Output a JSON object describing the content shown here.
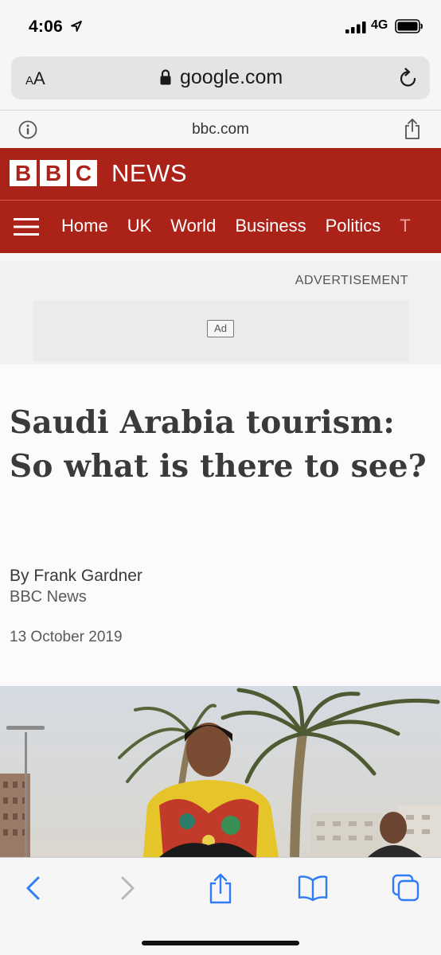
{
  "status_bar": {
    "time": "4:06",
    "network": "4G"
  },
  "browser": {
    "text_size_label_small": "A",
    "text_size_label_large": "A",
    "url": "google.com",
    "site_domain": "bbc.com"
  },
  "bbc": {
    "logo_letters": [
      "B",
      "B",
      "C"
    ],
    "news_word": "NEWS",
    "nav": [
      "Home",
      "UK",
      "World",
      "Business",
      "Politics",
      "T"
    ]
  },
  "ad": {
    "label": "ADVERTISEMENT",
    "badge": "Ad"
  },
  "article": {
    "headline": "Saudi Arabia tourism: So what is there to see?",
    "byline": "By Frank Gardner",
    "publisher": "BBC News",
    "date": "13 October 2019"
  },
  "colors": {
    "bbc_red": "#ab2219",
    "ios_blue": "#2f7cf6"
  },
  "icons": {
    "location": "location-arrow-icon",
    "signal": "cellular-signal-icon",
    "battery": "battery-icon",
    "lock": "lock-icon",
    "reload": "reload-icon",
    "info": "info-icon",
    "share": "share-icon",
    "menu": "hamburger-menu-icon",
    "back": "back-chevron-icon",
    "forward": "forward-chevron-icon",
    "bookmarks": "bookmarks-icon",
    "tabs": "tabs-icon"
  }
}
